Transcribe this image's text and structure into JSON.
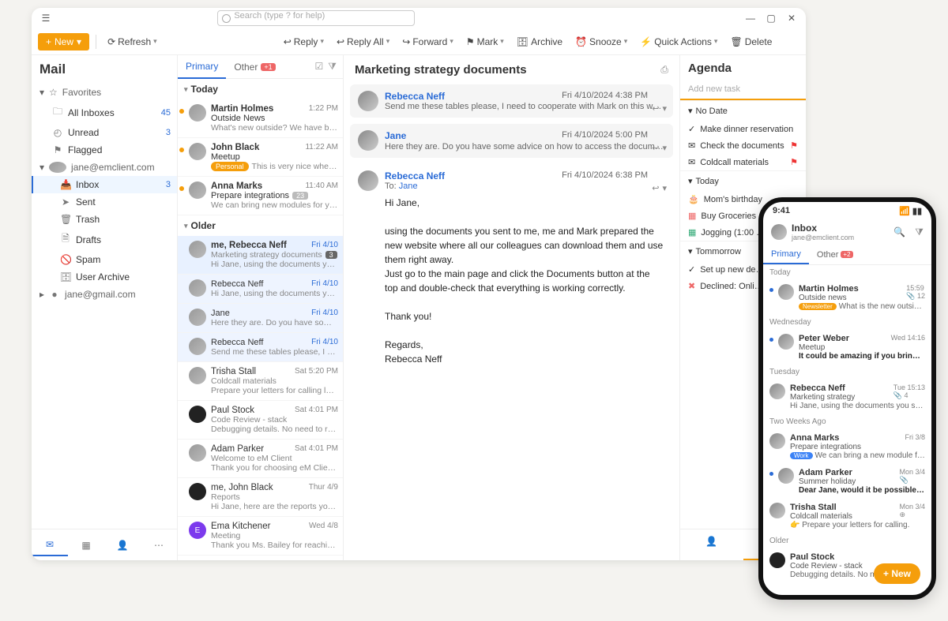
{
  "titlebar": {
    "search_placeholder": "Search (type ? for help)"
  },
  "toolbar": {
    "new": "New",
    "refresh": "Refresh",
    "reply": "Reply",
    "replyall": "Reply All",
    "forward": "Forward",
    "mark": "Mark",
    "archive": "Archive",
    "snooze": "Snooze",
    "quick": "Quick Actions",
    "delete": "Delete"
  },
  "sidebar": {
    "title": "Mail",
    "favorites": "Favorites",
    "allinboxes": "All Inboxes",
    "allinboxes_cnt": "45",
    "unread": "Unread",
    "unread_cnt": "3",
    "flagged": "Flagged",
    "acct1": "jane@emclient.com",
    "inbox": "Inbox",
    "inbox_cnt": "3",
    "sent": "Sent",
    "trash": "Trash",
    "drafts": "Drafts",
    "spam": "Spam",
    "userarchive": "User Archive",
    "acct2": "jane@gmail.com"
  },
  "tabs": {
    "primary": "Primary",
    "other": "Other",
    "other_badge": "+1"
  },
  "list": {
    "today": "Today",
    "older": "Older",
    "m1": {
      "from": "Martin Holmes",
      "sub": "Outside News",
      "prev": "What's new outside? We have been...",
      "time": "1:22 PM"
    },
    "m2": {
      "from": "John Black",
      "sub": "Meetup",
      "pill": "Personal",
      "prev": "This is very nice when y...",
      "time": "11:22 AM"
    },
    "m3": {
      "from": "Anna Marks",
      "sub": "Prepare integrations",
      "badge": "23",
      "prev": "We can bring new modules for you...",
      "time": "11:40 AM"
    },
    "o1": {
      "from": "me, Rebecca Neff",
      "sub": "Marketing strategy documents",
      "badge": "3",
      "prev": "Hi Jane, using the documents you s...",
      "time": "Fri 4/10"
    },
    "o2": {
      "from": "Rebecca Neff",
      "prev": "Hi Jane, using the documents you se...",
      "time": "Fri 4/10"
    },
    "o3": {
      "from": "Jane",
      "prev": "Here they are. Do you have some adv...",
      "time": "Fri 4/10"
    },
    "o4": {
      "from": "Rebecca Neff",
      "prev": "Send me these tables please, I need t...",
      "time": "Fri 4/10"
    },
    "o5": {
      "from": "Trisha Stall",
      "sub": "Coldcall materials",
      "prev": "Prepare your letters for calling later t...",
      "time": "Sat 5:20 PM"
    },
    "o6": {
      "from": "Paul Stock",
      "sub": "Code Review - stack",
      "prev": "Debugging details. No need to reply.",
      "time": "Sat 4:01 PM"
    },
    "o7": {
      "from": "Adam Parker",
      "sub": "Welcome to eM Client",
      "prev": "Thank you for choosing eM Client. It...",
      "time": "Sat 4:01 PM"
    },
    "o8": {
      "from": "me, John Black",
      "sub": "Reports",
      "prev": "Hi Jane, here are the reports you ask...",
      "time": "Thur 4/9"
    },
    "o9": {
      "from": "Ema Kitchener",
      "sub": "Meeting",
      "prev": "Thank you Ms. Bailey for reaching out...",
      "time": "Wed 4/8"
    }
  },
  "reading": {
    "subject": "Marketing strategy documents",
    "t1": {
      "from": "Rebecca Neff",
      "prev": "Send me these tables please, I need to cooperate with Mark on this website project…",
      "date": "Fri 4/10/2024 4:38 PM"
    },
    "t2": {
      "from": "Jane",
      "prev": "Here they are. Do you have some advice on how to access the documents once th…",
      "date": "Fri 4/10/2024 5:00 PM"
    },
    "t3": {
      "from": "Rebecca Neff",
      "to_lbl": "To:",
      "to": "Jane",
      "date": "Fri 4/10/2024 6:38 PM",
      "body1": "Hi Jane,",
      "body2": "using the documents you sent to me, me and Mark prepared the new website where all our colleagues can download them and use them right away.",
      "body3": "Just go to the main page and click the Documents button at the top and double-check that everything is working correctly.",
      "body4": "Thank you!",
      "body5": "Regards,",
      "body6": "Rebecca Neff"
    }
  },
  "agenda": {
    "title": "Agenda",
    "add": "Add new task",
    "nodate": "No Date",
    "i1": "Make dinner reservation",
    "i2": "Check the documents",
    "i3": "Coldcall materials",
    "today": "Today",
    "i4": "Mom's birthday",
    "i5": "Buy Groceries",
    "i6": "Jogging (1:00 …",
    "tomorrow": "Tommorrow",
    "i7": "Set up new de…",
    "i8": "Declined: Onli…"
  },
  "phone": {
    "time": "9:41",
    "inbox": "Inbox",
    "email": "jane@emclient.com",
    "primary": "Primary",
    "other": "Other",
    "other_badge": "+2",
    "g_today": "Today",
    "p1": {
      "from": "Martin Holmes",
      "sub": "Outside news",
      "pill": "Newsletter",
      "prev": "What is the new outside?",
      "time": "15:59",
      "att": "12"
    },
    "g_wed": "Wednesday",
    "p2": {
      "from": "Peter Weber",
      "sub": "Meetup",
      "prev": "It could be amazing if you bring some delicious…",
      "time": "Wed 14:16"
    },
    "g_tue": "Tuesday",
    "p3": {
      "from": "Rebecca Neff",
      "sub": "Marketing strategy",
      "prev": "Hi Jane, using the documents you send, I have m…",
      "time": "Tue 15:13",
      "att": "4"
    },
    "g_2w": "Two Weeks Ago",
    "p4": {
      "from": "Anna Marks",
      "sub": "Prepare integrations",
      "pill": "Work",
      "prev": "We can bring a new module for your…",
      "time": "Fri 3/8"
    },
    "p5": {
      "from": "Adam Parker",
      "sub": "Summer holiday",
      "prev": "Dear Jane, would it be possible for you to be in th…",
      "time": "Mon 3/4"
    },
    "p6": {
      "from": "Trisha Stall",
      "sub": "Coldcall materials",
      "prev": "👉 Prepare your letters for calling.",
      "time": "Mon 3/4"
    },
    "g_older": "Older",
    "p7": {
      "from": "Paul Stock",
      "sub": "Code Review - stack",
      "prev": "Debugging details. No need to reply."
    },
    "new": "New"
  }
}
